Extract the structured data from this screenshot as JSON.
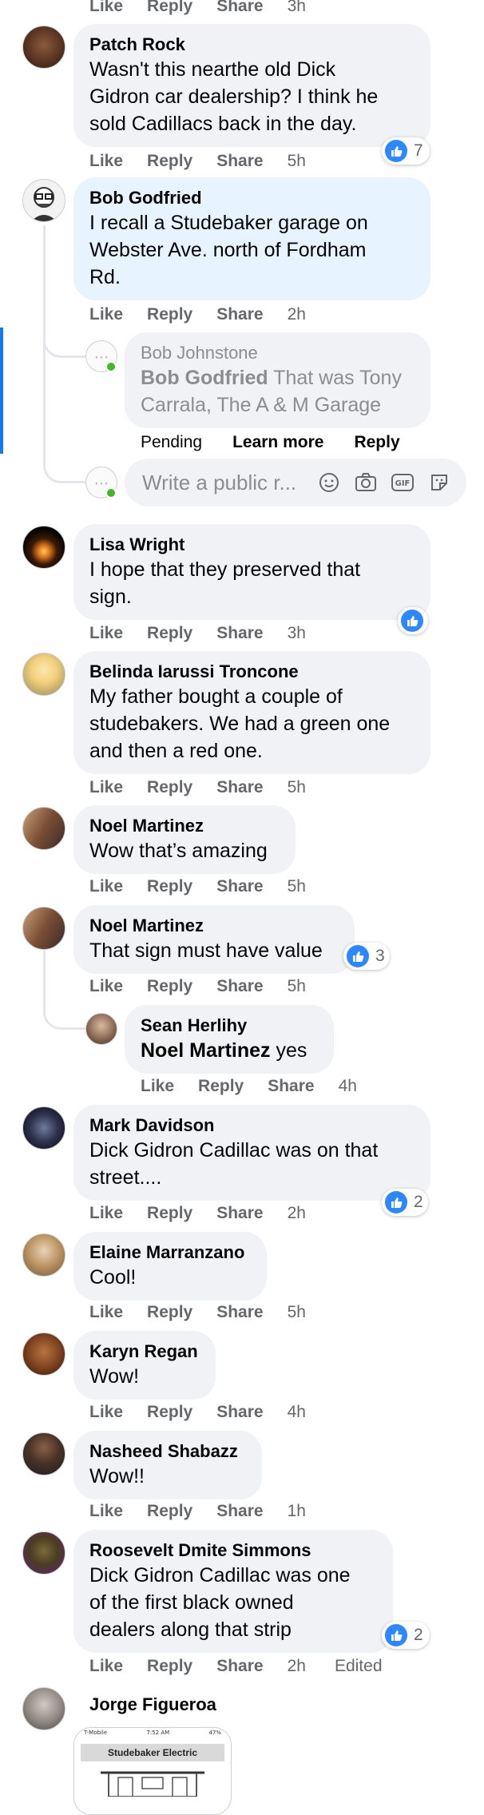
{
  "top_actions": {
    "like": "Like",
    "reply": "Reply",
    "share": "Share",
    "time": "3h"
  },
  "comments": [
    {
      "name": "Patch Rock",
      "lines": [
        "Wasn't this nearthe old Dick",
        "Gidron car dealership? I think he",
        "sold Cadillacs back in the day."
      ],
      "time": "5h",
      "reactions": "7"
    },
    {
      "name": "Bob Godfried",
      "lines": [
        "I recall a Studebaker garage on",
        "Webster Ave. north of Fordham",
        "Rd."
      ],
      "time": "2h"
    },
    {
      "name": "Lisa Wright",
      "lines": [
        "I hope that they preserved that",
        "sign."
      ],
      "time": "3h",
      "reactions": ""
    },
    {
      "name": "Belinda Iarussi Troncone",
      "lines": [
        "My father bought a couple of",
        "studebakers. We had a green one",
        "and then a red one."
      ],
      "time": "5h"
    },
    {
      "name": "Noel Martinez",
      "lines": [
        "Wow that’s amazing"
      ],
      "time": "5h"
    },
    {
      "name": "Noel Martinez",
      "lines": [
        "That sign must have value"
      ],
      "time": "5h",
      "reactions": "3"
    },
    {
      "name": "Mark Davidson",
      "lines": [
        "Dick Gidron Cadillac was on that",
        "street...."
      ],
      "time": "2h",
      "reactions": "2"
    },
    {
      "name": "Elaine Marranzano",
      "lines": [
        "Cool!"
      ],
      "time": "5h"
    },
    {
      "name": "Karyn Regan",
      "lines": [
        "Wow!"
      ],
      "time": "4h"
    },
    {
      "name": "Nasheed Shabazz",
      "lines": [
        "Wow!!"
      ],
      "time": "1h"
    },
    {
      "name": "Roosevelt Dmite Simmons",
      "lines": [
        "Dick Gidron Cadillac was one",
        "of the first black owned",
        "dealers along that strip"
      ],
      "time": "2h",
      "edited": "Edited",
      "reactions": "2"
    },
    {
      "name": "Jorge Figueroa"
    }
  ],
  "pending_reply": {
    "name": "Bob Johnstone",
    "tag": "Bob Godfried",
    "line1_rest": " That was Tony",
    "line2": "Carrala, The A & M Garage",
    "pending": "Pending",
    "learn_more": "Learn more",
    "reply": "Reply"
  },
  "reply_input": {
    "placeholder": "Write a public r..."
  },
  "sean_reply": {
    "name": "Sean Herlihy",
    "tag": "Noel Martinez",
    "rest": " yes",
    "time": "4h"
  },
  "labels": {
    "like": "Like",
    "reply": "Reply",
    "share": "Share"
  },
  "image_preview": {
    "status_left": "T-Mobile",
    "status_time": "7:52 AM",
    "status_right": "47%",
    "title": "Studebaker Electric"
  },
  "colors": {
    "like_blue": "#2d88ff",
    "bubble": "#f0f2f5",
    "highlight": "#e7f3ff",
    "link_bar": "#1877f2"
  }
}
